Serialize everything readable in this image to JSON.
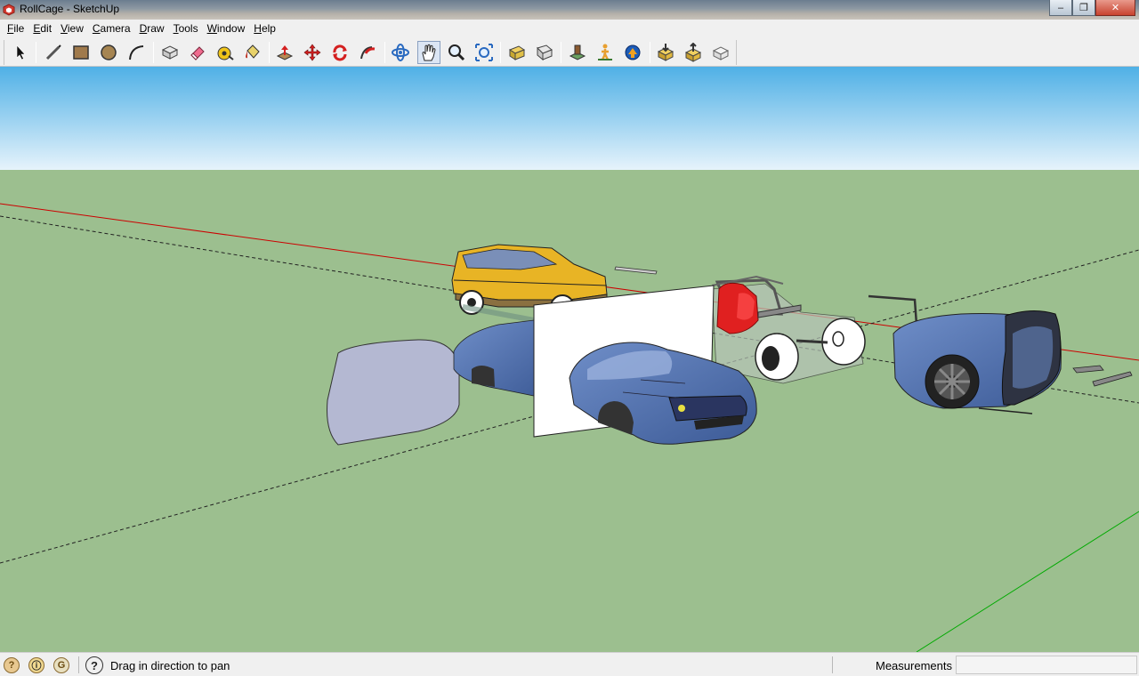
{
  "window": {
    "title": "RollCage - SketchUp",
    "buttons": {
      "minimize": "–",
      "maximize": "❐",
      "close": "✕"
    }
  },
  "menu": [
    {
      "label": "File",
      "mnemonic": "F",
      "rest": "ile"
    },
    {
      "label": "Edit",
      "mnemonic": "E",
      "rest": "dit"
    },
    {
      "label": "View",
      "mnemonic": "V",
      "rest": "iew"
    },
    {
      "label": "Camera",
      "mnemonic": "C",
      "rest": "amera"
    },
    {
      "label": "Draw",
      "mnemonic": "D",
      "rest": "raw"
    },
    {
      "label": "Tools",
      "mnemonic": "T",
      "rest": "ools"
    },
    {
      "label": "Window",
      "mnemonic": "W",
      "rest": "indow"
    },
    {
      "label": "Help",
      "mnemonic": "H",
      "rest": "elp"
    }
  ],
  "toolbar": {
    "tools": [
      "select-tool-icon",
      "line-tool-icon",
      "rectangle-tool-icon",
      "circle-tool-icon",
      "arc-tool-icon",
      "make-component-icon",
      "eraser-tool-icon",
      "tape-measure-icon",
      "paint-bucket-icon",
      "push-pull-icon",
      "move-tool-icon",
      "rotate-tool-icon",
      "follow-me-icon",
      "orbit-tool-icon",
      "pan-tool-icon",
      "zoom-tool-icon",
      "zoom-extents-icon",
      "previous-view-icon",
      "next-view-icon",
      "position-camera-icon",
      "walk-tool-icon",
      "look-around-icon",
      "get-models-icon",
      "share-model-icon",
      "share-component-icon"
    ],
    "active_tool": "pan-tool-icon"
  },
  "scene": {
    "sky_top": "#4fb0e6",
    "sky_bottom": "#e6f3fb",
    "ground": "#9cbf8f",
    "axis_red": "#cc0000",
    "axis_green": "#00aa00",
    "car_blue": "#5a78b4",
    "jeep_yellow": "#e8b425",
    "engine_red": "#e02020"
  },
  "status": {
    "hint": "Drag in direction to pan",
    "measurements_label": "Measurements",
    "measurements_value": ""
  }
}
